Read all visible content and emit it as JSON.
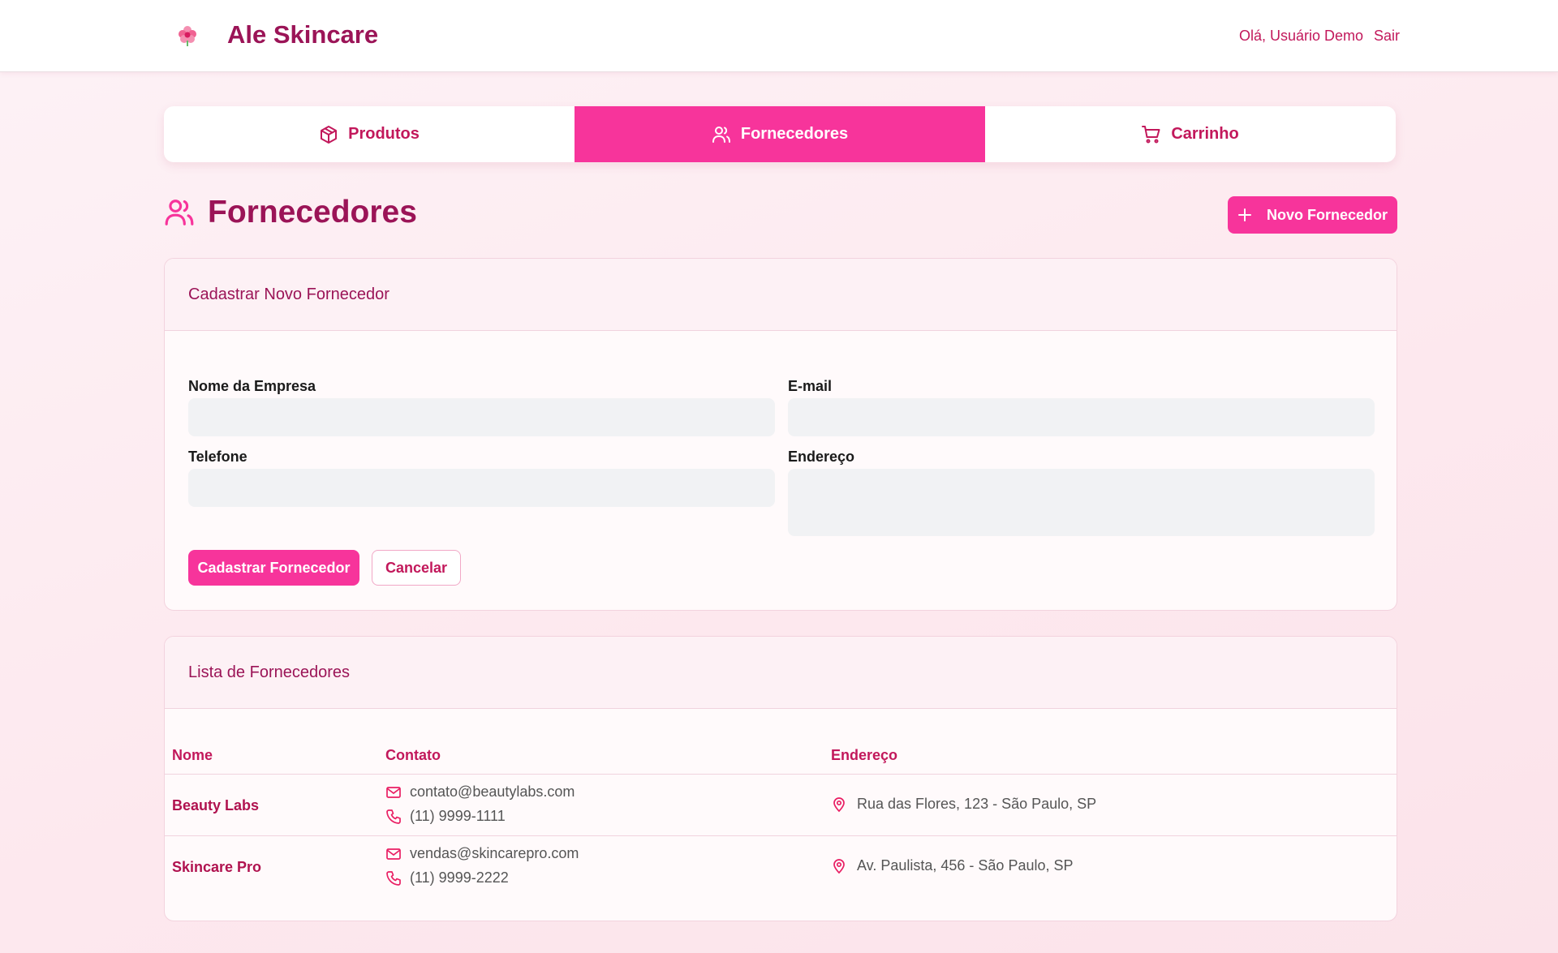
{
  "header": {
    "brand": "Ale Skincare",
    "greeting": "Olá, Usuário Demo",
    "logout": "Sair",
    "logo_icon": "flower-icon"
  },
  "tabs": [
    {
      "label": "Produtos",
      "icon": "package-icon",
      "active": false
    },
    {
      "label": "Fornecedores",
      "icon": "users-icon",
      "active": true
    },
    {
      "label": "Carrinho",
      "icon": "cart-icon",
      "active": false
    }
  ],
  "page": {
    "title": "Fornecedores",
    "new_button": "Novo Fornecedor"
  },
  "form": {
    "title": "Cadastrar Novo Fornecedor",
    "company_label": "Nome da Empresa",
    "company_value": "",
    "email_label": "E-mail",
    "email_value": "",
    "phone_label": "Telefone",
    "phone_value": "",
    "address_label": "Endereço",
    "address_value": "",
    "submit": "Cadastrar Fornecedor",
    "cancel": "Cancelar"
  },
  "list": {
    "title": "Lista de Fornecedores",
    "columns": [
      "Nome",
      "Contato",
      "Endereço"
    ],
    "rows": [
      {
        "name": "Beauty Labs",
        "email": "contato@beautylabs.com",
        "phone": "(11) 9999-1111",
        "address": "Rua das Flores, 123 - São Paulo, SP"
      },
      {
        "name": "Skincare Pro",
        "email": "vendas@skincarepro.com",
        "phone": "(11) 9999-2222",
        "address": "Av. Paulista, 456 - São Paulo, SP"
      }
    ]
  },
  "colors": {
    "primary": "#f7349b",
    "brand_text": "#9b1457",
    "accent_text": "#c2185b"
  }
}
